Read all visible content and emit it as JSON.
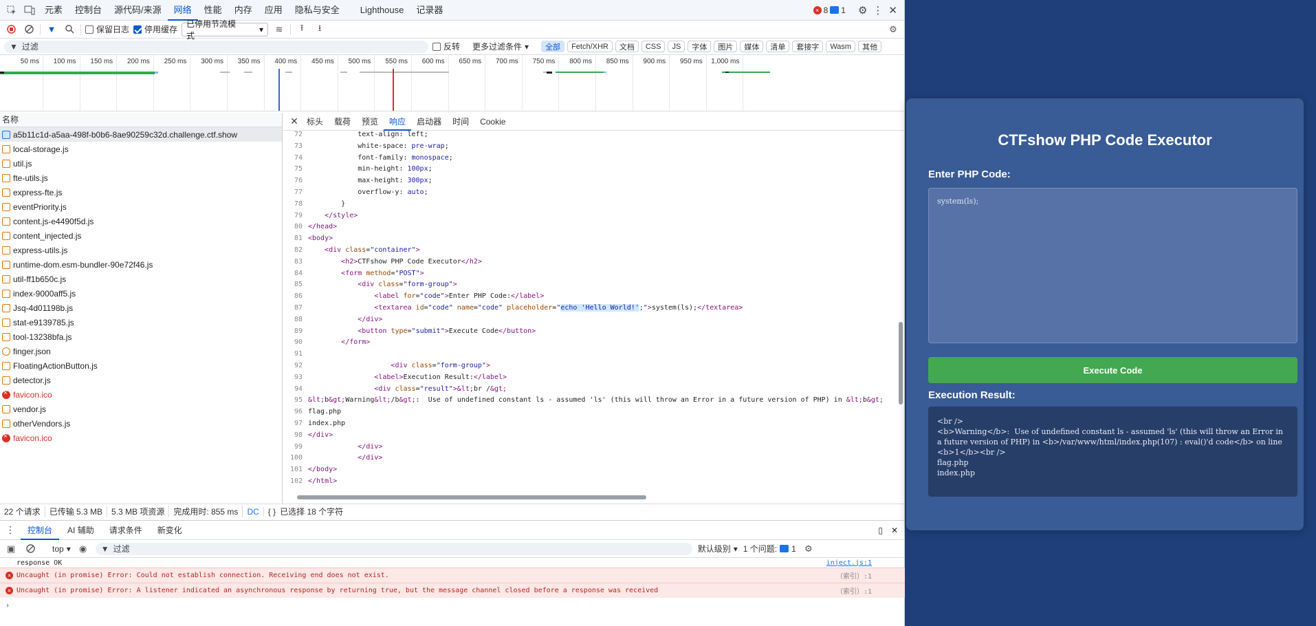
{
  "devtools": {
    "tabs": [
      "元素",
      "控制台",
      "源代码/来源",
      "网络",
      "性能",
      "内存",
      "应用",
      "隐私与安全",
      "Lighthouse",
      "记录器"
    ],
    "active_tab": "网络",
    "error_count": "8",
    "message_count": "1",
    "toolbar": {
      "preserve_log": "保留日志",
      "disable_cache": "停用缓存",
      "throttle": "已停用节流模式"
    },
    "filter": {
      "placeholder": "过滤",
      "invert": "反转",
      "more_filters": "更多过滤条件",
      "types": [
        "全部",
        "Fetch/XHR",
        "文档",
        "CSS",
        "JS",
        "字体",
        "图片",
        "媒体",
        "清单",
        "套接字",
        "Wasm",
        "其他"
      ]
    },
    "timeline_ticks": [
      "50 ms",
      "100 ms",
      "150 ms",
      "200 ms",
      "250 ms",
      "300 ms",
      "350 ms",
      "400 ms",
      "450 ms",
      "500 ms",
      "550 ms",
      "600 ms",
      "650 ms",
      "700 ms",
      "750 ms",
      "800 ms",
      "850 ms",
      "900 ms",
      "950 ms",
      "1,000 ms"
    ],
    "name_header": "名称",
    "requests": [
      {
        "name": "a5b11c1d-a5aa-498f-b0b6-8ae90259c32d.challenge.ctf.show",
        "kind": "doc",
        "selected": true
      },
      {
        "name": "local-storage.js",
        "kind": "js"
      },
      {
        "name": "util.js",
        "kind": "js"
      },
      {
        "name": "fte-utils.js",
        "kind": "js"
      },
      {
        "name": "express-fte.js",
        "kind": "js"
      },
      {
        "name": "eventPriority.js",
        "kind": "js"
      },
      {
        "name": "content.js-e4490f5d.js",
        "kind": "js"
      },
      {
        "name": "content_injected.js",
        "kind": "js"
      },
      {
        "name": "express-utils.js",
        "kind": "js"
      },
      {
        "name": "runtime-dom.esm-bundler-90e72f46.js",
        "kind": "js"
      },
      {
        "name": "util-ff1b650c.js",
        "kind": "js"
      },
      {
        "name": "index-9000aff5.js",
        "kind": "js"
      },
      {
        "name": "Jsq-4d01198b.js",
        "kind": "js"
      },
      {
        "name": "stat-e9139785.js",
        "kind": "js"
      },
      {
        "name": "tool-13238bfa.js",
        "kind": "js"
      },
      {
        "name": "finger.json",
        "kind": "json"
      },
      {
        "name": "FloatingActionButton.js",
        "kind": "js"
      },
      {
        "name": "detector.js",
        "kind": "js"
      },
      {
        "name": "favicon.ico",
        "kind": "err"
      },
      {
        "name": "vendor.js",
        "kind": "js"
      },
      {
        "name": "otherVendors.js",
        "kind": "js"
      },
      {
        "name": "favicon.ico",
        "kind": "err"
      }
    ],
    "panel_tabs": [
      "标头",
      "载荷",
      "预览",
      "响应",
      "启动器",
      "时间",
      "Cookie"
    ],
    "panel_active": "响应",
    "code_lines": [
      {
        "n": "72",
        "html": "            text-align: left;"
      },
      {
        "n": "73",
        "html": "            white-space: <span class=\"av\">pre-wrap</span>;"
      },
      {
        "n": "74",
        "html": "            font-family: <span class=\"av\">monospace</span>;"
      },
      {
        "n": "75",
        "html": "            min-height: <span class=\"av\">100px</span>;"
      },
      {
        "n": "76",
        "html": "            max-height: <span class=\"av\">300px</span>;"
      },
      {
        "n": "77",
        "html": "            overflow-y: <span class=\"av\">auto</span>;"
      },
      {
        "n": "78",
        "html": "        }"
      },
      {
        "n": "79",
        "html": "    <span class=\"tg\">&lt;/style&gt;</span>"
      },
      {
        "n": "80",
        "html": "<span class=\"tg\">&lt;/head&gt;</span>"
      },
      {
        "n": "81",
        "html": "<span class=\"tg\">&lt;body&gt;</span>"
      },
      {
        "n": "82",
        "html": "    <span class=\"tg\">&lt;div</span> <span class=\"at\">class</span>=<span class=\"av\">\"container\"</span><span class=\"tg\">&gt;</span>"
      },
      {
        "n": "83",
        "html": "        <span class=\"tg\">&lt;h2&gt;</span>CTFshow PHP Code Executor<span class=\"tg\">&lt;/h2&gt;</span>"
      },
      {
        "n": "84",
        "html": "        <span class=\"tg\">&lt;form</span> <span class=\"at\">method</span>=<span class=\"av\">\"POST\"</span><span class=\"tg\">&gt;</span>"
      },
      {
        "n": "85",
        "html": "            <span class=\"tg\">&lt;div</span> <span class=\"at\">class</span>=<span class=\"av\">\"form-group\"</span><span class=\"tg\">&gt;</span>"
      },
      {
        "n": "86",
        "html": "                <span class=\"tg\">&lt;label</span> <span class=\"at\">for</span>=<span class=\"av\">\"code\"</span><span class=\"tg\">&gt;</span>Enter PHP Code:<span class=\"tg\">&lt;/label&gt;</span>"
      },
      {
        "n": "87",
        "html": "                <span class=\"tg\">&lt;textarea</span> <span class=\"at\">id</span>=<span class=\"av\">\"code\"</span> <span class=\"at\">name</span>=<span class=\"av\">\"code\"</span> <span class=\"at\">placeholder</span>=<span class=\"av\">\"<span class=\"hl\">echo 'Hello World!'</span>;\"</span><span class=\"tg\">&gt;</span>system(ls);<span class=\"tg\">&lt;/textarea&gt;</span>"
      },
      {
        "n": "88",
        "html": "            <span class=\"tg\">&lt;/div&gt;</span>"
      },
      {
        "n": "89",
        "html": "            <span class=\"tg\">&lt;button</span> <span class=\"at\">type</span>=<span class=\"av\">\"submit\"</span><span class=\"tg\">&gt;</span>Execute Code<span class=\"tg\">&lt;/button&gt;</span>"
      },
      {
        "n": "90",
        "html": "        <span class=\"tg\">&lt;/form&gt;</span>"
      },
      {
        "n": "91",
        "html": ""
      },
      {
        "n": "92",
        "html": "                    <span class=\"tg\">&lt;div</span> <span class=\"at\">class</span>=<span class=\"av\">\"form-group\"</span><span class=\"tg\">&gt;</span>"
      },
      {
        "n": "93",
        "html": "                <span class=\"tg\">&lt;label&gt;</span>Execution Result:<span class=\"tg\">&lt;/label&gt;</span>"
      },
      {
        "n": "94",
        "html": "                <span class=\"tg\">&lt;div</span> <span class=\"at\">class</span>=<span class=\"av\">\"result\"</span><span class=\"tg\">&gt;</span><span class=\"tg\">&amp;lt;</span>br /<span class=\"tg\">&amp;gt;</span>"
      },
      {
        "n": "95",
        "html": "<span class=\"tg\">&amp;lt;</span>b<span class=\"tg\">&amp;gt;</span>Warning<span class=\"tg\">&amp;lt;</span>/b<span class=\"tg\">&amp;gt;</span>:  Use of undefined constant ls - assumed 'ls' (this will throw an Error in a future version of PHP) in <span class=\"tg\">&amp;lt;</span>b<span class=\"tg\">&amp;gt;</span>"
      },
      {
        "n": "96",
        "html": "flag.php"
      },
      {
        "n": "97",
        "html": "index.php"
      },
      {
        "n": "98",
        "html": "<span class=\"tg\">&lt;/div&gt;</span>"
      },
      {
        "n": "99",
        "html": "            <span class=\"tg\">&lt;/div&gt;</span>"
      },
      {
        "n": "100",
        "html": "            <span class=\"tg\">&lt;/div&gt;</span>"
      },
      {
        "n": "101",
        "html": "<span class=\"tg\">&lt;/body&gt;</span>"
      },
      {
        "n": "102",
        "html": "<span class=\"tg\">&lt;/html&gt;</span>"
      }
    ],
    "status": {
      "requests": "22 个请求",
      "transferred": "已传输 5.3 MB",
      "resources": "5.3 MB 项资源",
      "finish": "完成用时: 855 ms",
      "dom": "DC",
      "selection": "已选择 18 个字符"
    },
    "drawer": {
      "tabs": [
        "控制台",
        "AI 辅助",
        "请求条件",
        "新变化"
      ],
      "active": "控制台",
      "context": "top",
      "filter_placeholder": "过滤",
      "level": "默认级别",
      "issues": "1 个问题:",
      "issues_count": "1",
      "messages": [
        {
          "type": "log",
          "text": "response OK",
          "src": "inject.js:1"
        },
        {
          "type": "err",
          "text": "Uncaught (in promise) Error: Could not establish connection. Receiving end does not exist.",
          "src": "（索引）:1"
        },
        {
          "type": "err",
          "text": "Uncaught (in promise) Error: A listener indicated an asynchronous response by returning true, but the message channel closed before a response was received",
          "src": "（索引）:1"
        }
      ]
    }
  },
  "page": {
    "title": "CTFshow PHP Code Executor",
    "code_label": "Enter PHP Code:",
    "code_value": "system(ls);",
    "button": "Execute Code",
    "result_label": "Execution Result:",
    "result_text": "<br />\n<b>Warning</b>:  Use of undefined constant ls - assumed 'ls' (this will throw an Error in a future version of PHP) in <b>/var/www/html/index.php(107) : eval()'d code</b> on line <b>1</b><br />\nflag.php\nindex.php"
  }
}
